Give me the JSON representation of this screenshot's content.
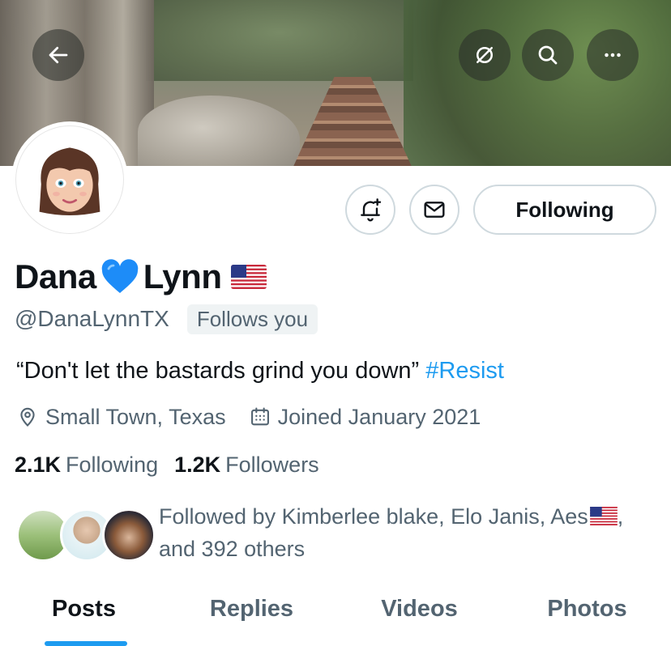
{
  "banner": {
    "image": "hiking-trail-photo"
  },
  "header_actions": {
    "back_icon": "arrow-left-icon",
    "grok_icon": "slash-circle-icon",
    "search_icon": "search-icon",
    "more_icon": "more-dots-icon"
  },
  "profile": {
    "name_first": "Dana",
    "name_last": "Lynn",
    "name_emoji": "blue-heart-icon",
    "name_flag": "us-flag-icon",
    "handle": "@DanaLynnTX",
    "follows_you": "Follows you",
    "bio_text": "“Don't let the bastards grind you down”",
    "bio_hashtag": "#Resist",
    "location": "Small Town, Texas",
    "joined": "Joined January 2021"
  },
  "actions": {
    "notify_icon": "bell-plus-icon",
    "message_icon": "envelope-icon",
    "following_label": "Following"
  },
  "stats": {
    "following_count": "2.1K",
    "following_label": "Following",
    "followers_count": "1.2K",
    "followers_label": "Followers"
  },
  "mutuals": {
    "line1": "Followed by Kimberlee blake, Elo Janis, Aes",
    "line1_suffix": ",",
    "line2": "and 392 others"
  },
  "tabs": [
    {
      "label": "Posts",
      "active": true
    },
    {
      "label": "Replies",
      "active": false
    },
    {
      "label": "Videos",
      "active": false
    },
    {
      "label": "Photos",
      "active": false
    }
  ],
  "colors": {
    "accent": "#1d9bf0",
    "secondary_text": "#536471",
    "primary_text": "#0f1419",
    "border": "#cfd9de"
  }
}
